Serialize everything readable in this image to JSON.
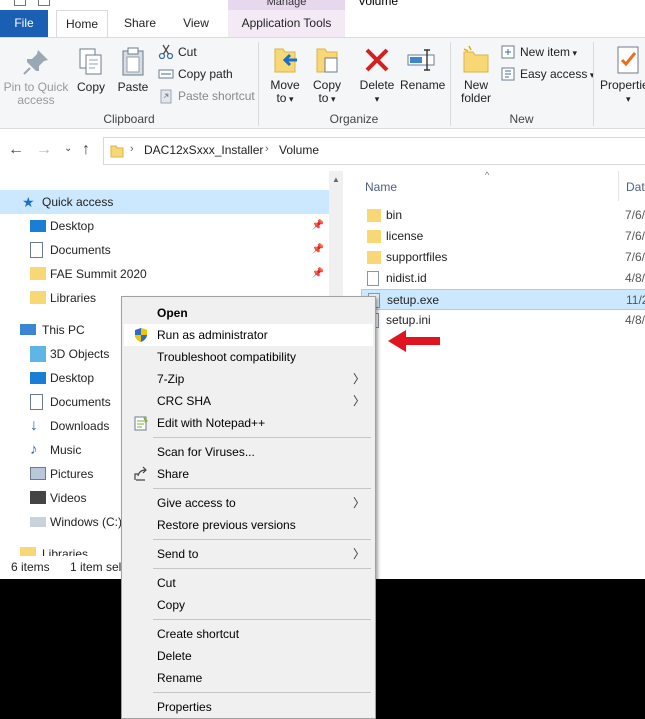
{
  "window": {
    "title": "Volume",
    "contextual_tab_group": "Manage"
  },
  "tabs": [
    {
      "label": "File"
    },
    {
      "label": "Home"
    },
    {
      "label": "Share"
    },
    {
      "label": "View"
    },
    {
      "label": "Application Tools"
    }
  ],
  "ribbon": {
    "clipboard": {
      "pin_label_1": "Pin to Quick",
      "pin_label_2": "access",
      "copy": "Copy",
      "paste": "Paste",
      "cut": "Cut",
      "copy_path": "Copy path",
      "paste_shortcut": "Paste shortcut",
      "group": "Clipboard"
    },
    "organize": {
      "move_to_1": "Move",
      "move_to_2": "to",
      "copy_to_1": "Copy",
      "copy_to_2": "to",
      "delete": "Delete",
      "rename": "Rename",
      "group": "Organize"
    },
    "new": {
      "new_folder_1": "New",
      "new_folder_2": "folder",
      "new_item": "New item",
      "easy_access": "Easy access",
      "group": "New"
    },
    "open": {
      "properties": "Properties"
    }
  },
  "address": {
    "crumbs": [
      "DAC12xSxxx_Installer",
      "Volume"
    ]
  },
  "nav": {
    "items": [
      {
        "label": "Quick access"
      },
      {
        "label": "Desktop"
      },
      {
        "label": "Documents"
      },
      {
        "label": "FAE Summit 2020"
      },
      {
        "label": "Libraries"
      },
      {
        "label": "This PC"
      },
      {
        "label": "3D Objects"
      },
      {
        "label": "Desktop"
      },
      {
        "label": "Documents"
      },
      {
        "label": "Downloads"
      },
      {
        "label": "Music"
      },
      {
        "label": "Pictures"
      },
      {
        "label": "Videos"
      },
      {
        "label": "Windows (C:)"
      },
      {
        "label": "Libraries"
      }
    ]
  },
  "files": {
    "col_name": "Name",
    "col_date": "Dat",
    "rows": [
      {
        "name": "bin",
        "date": "7/6/"
      },
      {
        "name": "license",
        "date": "7/6/"
      },
      {
        "name": "supportfiles",
        "date": "7/6/"
      },
      {
        "name": "nidist.id",
        "date": "4/8/"
      },
      {
        "name": "setup.exe",
        "date": "11/2"
      },
      {
        "name": "setup.ini",
        "date": "4/8/"
      }
    ]
  },
  "status": {
    "count": "6 items",
    "selected": "1 item sel"
  },
  "context_menu": {
    "items": [
      {
        "label": "Open"
      },
      {
        "label": "Run as administrator"
      },
      {
        "label": "Troubleshoot compatibility"
      },
      {
        "label": "7-Zip"
      },
      {
        "label": "CRC SHA"
      },
      {
        "label": "Edit with Notepad++"
      },
      {
        "label": "Scan for Viruses..."
      },
      {
        "label": "Share"
      },
      {
        "label": "Give access to"
      },
      {
        "label": "Restore previous versions"
      },
      {
        "label": "Send to"
      },
      {
        "label": "Cut"
      },
      {
        "label": "Copy"
      },
      {
        "label": "Create shortcut"
      },
      {
        "label": "Delete"
      },
      {
        "label": "Rename"
      },
      {
        "label": "Properties"
      }
    ]
  },
  "colors": {
    "file_tab": "#1a5fb4",
    "selection": "#cce8ff",
    "folder": "#f8d775",
    "annotation_arrow": "#e0141e",
    "delete_x": "#d42020"
  }
}
